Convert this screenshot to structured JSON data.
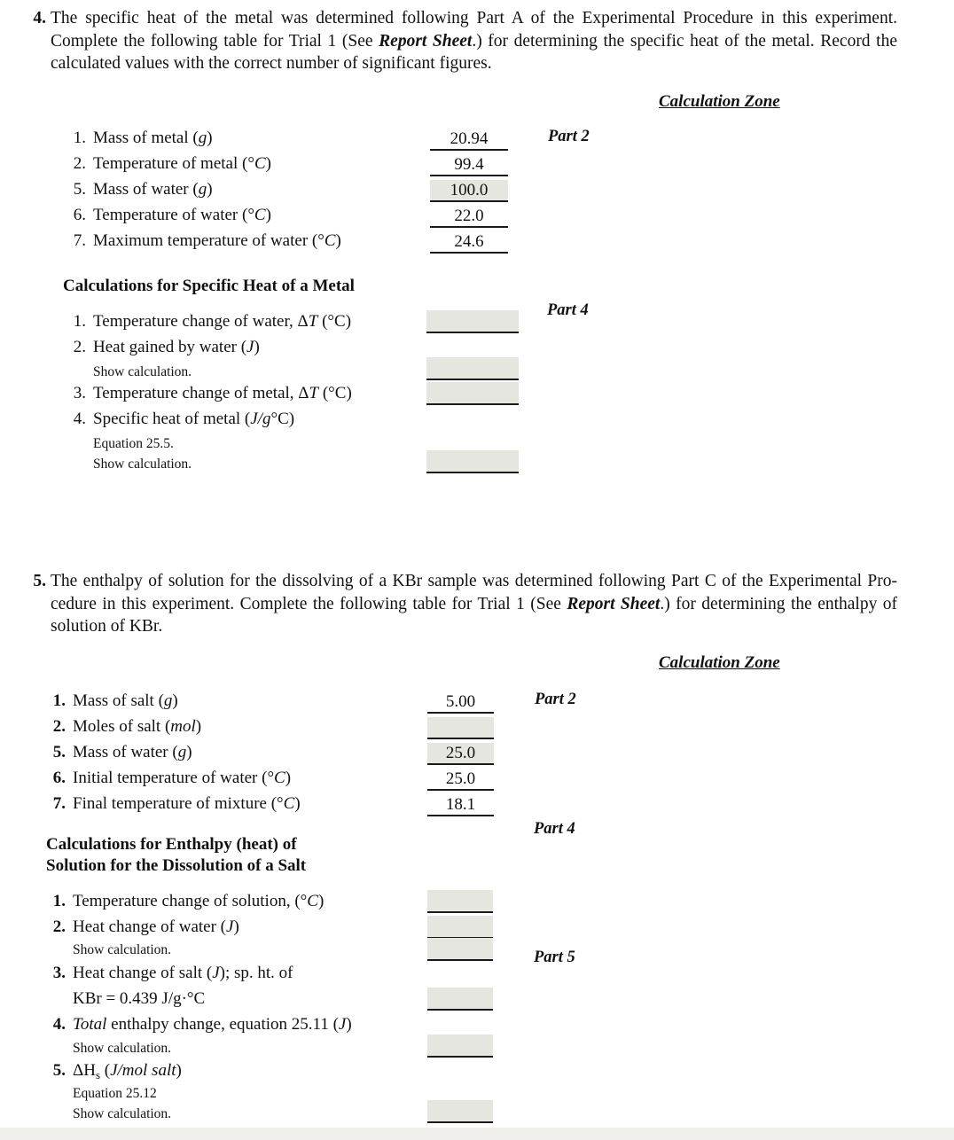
{
  "questions": [
    {
      "number": "4.",
      "prompt_line1": "The specific heat of the metal was determined following Part A of the Experimental Procedure in this experiment.",
      "prompt_line2_a": "Complete the following table for Trial 1 (See ",
      "prompt_line2_b": "Report Sheet",
      "prompt_line2_c": ".) for determining the specific heat of the metal. Record the",
      "prompt_line3": "calculated values with the correct number of significant figures.",
      "calculation_zone_label": "Calculation Zone",
      "part_labels": [
        {
          "text": "Part 2"
        },
        {
          "text": "Part 4"
        }
      ],
      "data_rows": [
        {
          "num": "1.",
          "label": "Mass of metal (",
          "unit": "g",
          "label_end": ")",
          "value": "20.94",
          "shaded": false
        },
        {
          "num": "2.",
          "label": "Temperature of metal (°",
          "unit": "C",
          "label_end": ")",
          "value": "99.4",
          "shaded": false
        },
        {
          "num": "5.",
          "label": "Mass of water (",
          "unit": "g",
          "label_end": ")",
          "value": "100.0",
          "shaded": true
        },
        {
          "num": "6.",
          "label": "Temperature of water (°",
          "unit": "C",
          "label_end": ")",
          "value": "22.0",
          "shaded": false
        },
        {
          "num": "7.",
          "label": "Maximum temperature of water (°",
          "unit": "C",
          "label_end": ")",
          "value": "24.6",
          "shaded": false
        }
      ],
      "calc_heading": "Calculations for Specific Heat of a Metal",
      "calc_rows": [
        {
          "num": "1.",
          "label_a": "Temperature change of water, Δ",
          "label_i": "T",
          "label_b": " (°C)",
          "value": ""
        },
        {
          "num": "2.",
          "label_a": "Heat gained by water (",
          "label_i": "J",
          "label_b": ")",
          "value": ""
        },
        {
          "num": "3.",
          "label_a": "Temperature change of metal, Δ",
          "label_i": "T",
          "label_b": " (°C)",
          "value": ""
        },
        {
          "num": "4.",
          "label_a": "Specific heat of metal (",
          "label_i": "J/g",
          "label_b": "°C)",
          "value": ""
        }
      ],
      "notes": [
        "Show calculation.",
        "Equation 25.5.",
        "Show calculation."
      ]
    },
    {
      "number": "5.",
      "prompt_line1": "The enthalpy of solution for the dissolving of a KBr sample was determined following Part C of the Experimental Pro-",
      "prompt_line2_a": "cedure in this experiment. Complete the following table for Trial 1 (See ",
      "prompt_line2_b": "Report Sheet",
      "prompt_line2_c": ".) for determining the enthalpy of",
      "prompt_line3": "solution of KBr.",
      "calculation_zone_label": "Calculation Zone",
      "part_labels": [
        {
          "text": "Part 2"
        },
        {
          "text": "Part 4"
        },
        {
          "text": "Part 5"
        }
      ],
      "data_rows": [
        {
          "num": "1.",
          "label": "Mass of salt (",
          "unit": "g",
          "label_end": ")",
          "value": "5.00",
          "shaded": false
        },
        {
          "num": "2.",
          "label": "Moles of salt (",
          "unit": "mol",
          "label_end": ")",
          "value": "",
          "shaded": true
        },
        {
          "num": "5.",
          "label": "Mass of water (",
          "unit": "g",
          "label_end": ")",
          "value": "25.0",
          "shaded": true
        },
        {
          "num": "6.",
          "label": "Initial temperature of water (°",
          "unit": "C",
          "label_end": ")",
          "value": "25.0",
          "shaded": false
        },
        {
          "num": "7.",
          "label": "Final temperature of mixture (°",
          "unit": "C",
          "label_end": ")",
          "value": "18.1",
          "shaded": false
        }
      ],
      "calc_heading_line1": "Calculations for Enthalpy (heat) of",
      "calc_heading_line2": "Solution for the Dissolution of a Salt",
      "calc_rows": [
        {
          "num": "1.",
          "label_a": "Temperature change of solution, (°",
          "label_i": "C",
          "label_b": ")",
          "value": ""
        },
        {
          "num": "2.",
          "label_a": "Heat change of water (",
          "label_i": "J",
          "label_b": ")",
          "value": ""
        },
        {
          "num": "3.",
          "label_a": "Heat change of salt (",
          "label_i": "J",
          "label_b": "); sp. ht. of",
          "value": ""
        },
        {
          "num": "",
          "label_a": "KBr = 0.439 J/g·°C",
          "label_i": "",
          "label_b": "",
          "value": ""
        },
        {
          "num": "4.",
          "label_a": "",
          "label_i": "Total",
          "label_b": " enthalpy change, equation 25.11 (",
          "label_i2": "J",
          "label_c": ")",
          "value": ""
        },
        {
          "num": "5.",
          "label_a": "ΔH",
          "label_sub": "s",
          "label_b": " (",
          "label_i": "J/mol salt",
          "label_c": ")",
          "value": ""
        }
      ],
      "notes": [
        "Show calculation.",
        "Show calculation.",
        "Equation 25.12",
        "Show calculation."
      ]
    }
  ]
}
